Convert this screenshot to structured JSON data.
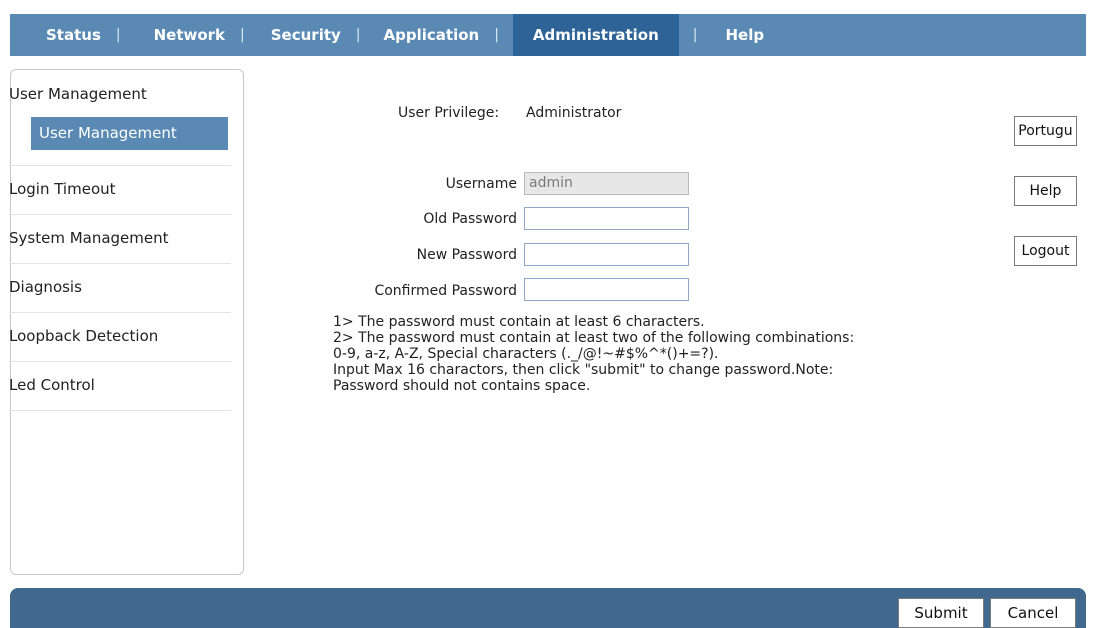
{
  "nav": {
    "items": [
      {
        "label": "Status"
      },
      {
        "label": "Network"
      },
      {
        "label": "Security"
      },
      {
        "label": "Application"
      },
      {
        "label": "Administration"
      },
      {
        "label": "Help"
      }
    ],
    "separator": "|",
    "active": "Administration"
  },
  "sidebar": {
    "items": [
      {
        "label": "User Management"
      },
      {
        "label": "Login Timeout"
      },
      {
        "label": "System Management"
      },
      {
        "label": "Diagnosis"
      },
      {
        "label": "Loopback Detection"
      },
      {
        "label": "Led Control"
      }
    ],
    "sub_items": [
      {
        "label": "User Management"
      }
    ]
  },
  "form": {
    "privilege_label": "User Privilege:",
    "privilege_value": "Administrator",
    "username_label": "Username",
    "username_value": "admin",
    "old_password_label": "Old Password",
    "old_password_value": "",
    "new_password_label": "New Password",
    "new_password_value": "",
    "confirm_password_label": "Confirmed Password",
    "confirm_password_value": ""
  },
  "notes": [
    "1> The password must contain at least 6 characters.",
    "2> The password must contain at least two of the following combinations:",
    "0-9, a-z, A-Z, Special characters (._/@!~#$%^*()+=?).",
    "Input Max 16 charactors, then click \"submit\" to change password.Note:",
    "Password should not contains space."
  ],
  "right_buttons": {
    "language": "Portugu",
    "help": "Help",
    "logout": "Logout"
  },
  "footer": {
    "submit": "Submit",
    "cancel": "Cancel"
  },
  "colors": {
    "nav_bg": "#5a8ab4",
    "nav_active_bg": "#2d6397",
    "footer_bg": "#41698f"
  }
}
